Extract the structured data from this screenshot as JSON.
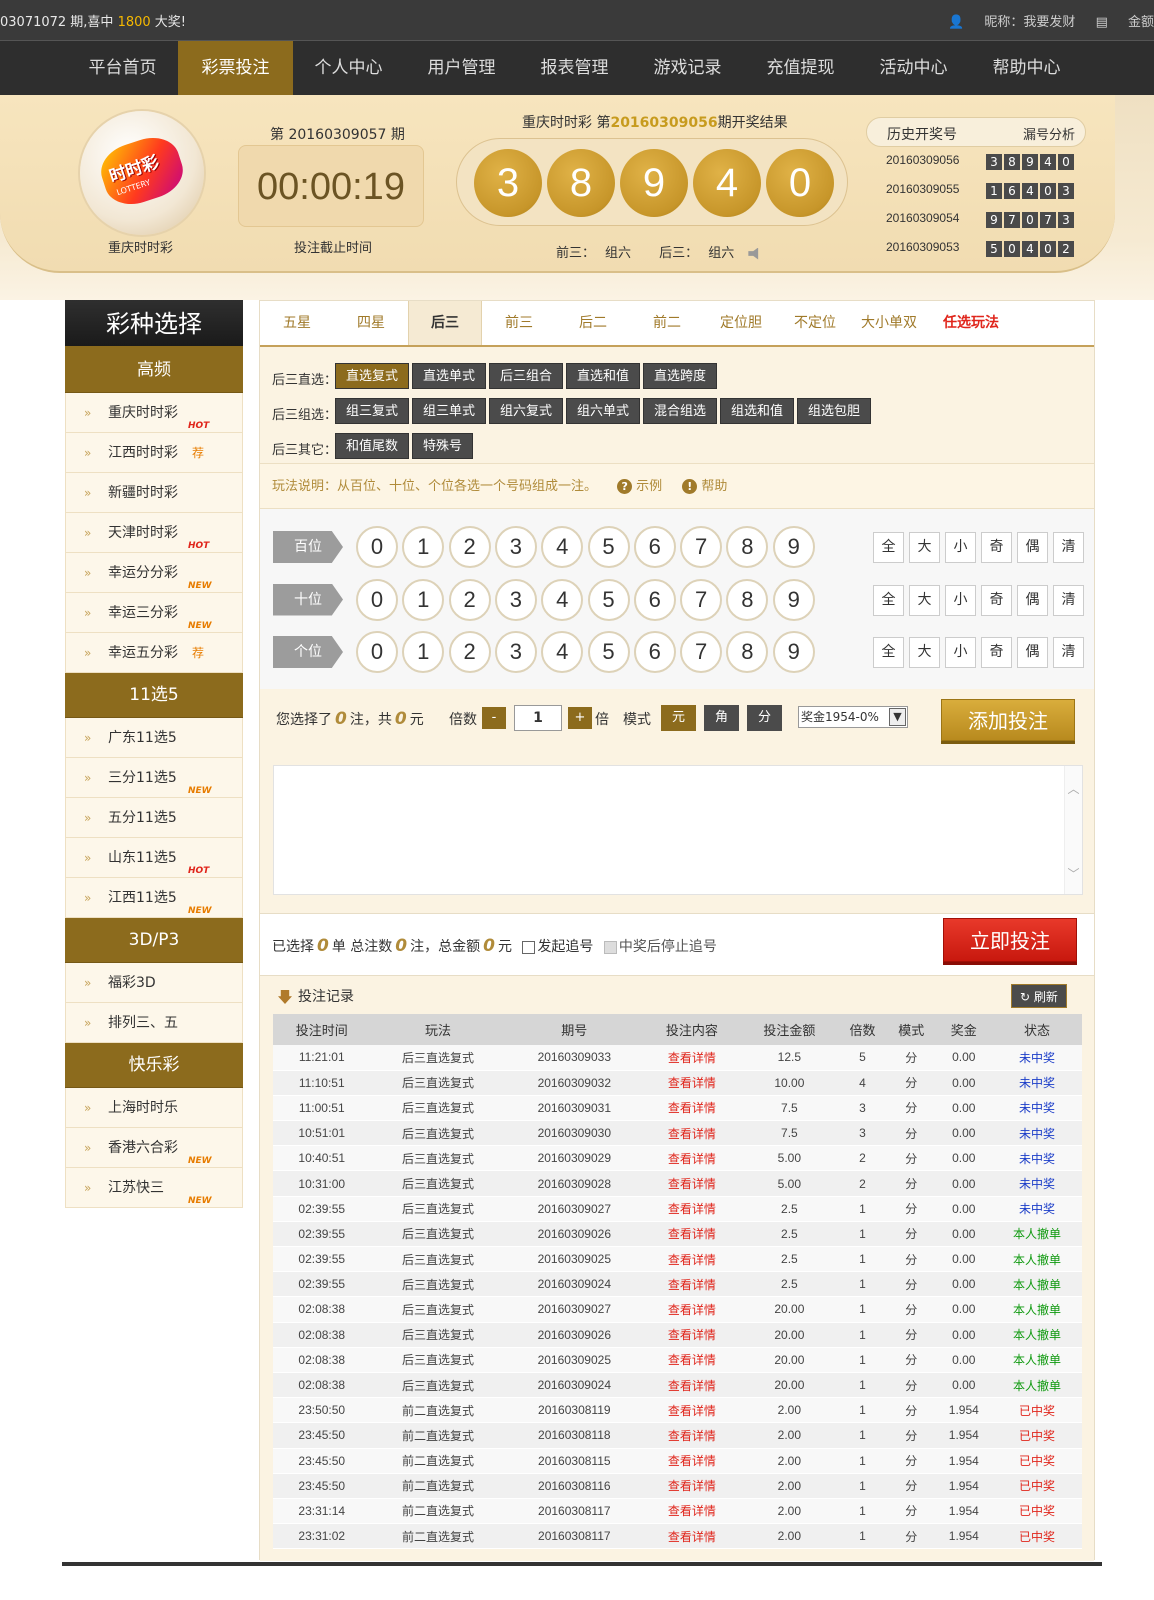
{
  "topbar": {
    "notice_prefix": "03071072 期,喜中 ",
    "notice_amount": "1800",
    "notice_suffix": " 大奖!",
    "nickname": "昵称：我要发财",
    "balance": "金额"
  },
  "nav": [
    "平台首页",
    "彩票投注",
    "个人中心",
    "用户管理",
    "报表管理",
    "游戏记录",
    "充值提现",
    "活动中心",
    "帮助中心"
  ],
  "nav_active": 1,
  "hero": {
    "game_name": "重庆时时彩",
    "logo_text": "时时彩",
    "logo_sub": "LOTTERY",
    "period": "第 20160309057 期",
    "countdown": "00:00:19",
    "countdown_label": "投注截止时间",
    "draw_title_prefix": "重庆时时彩 第",
    "draw_period": "20160309056",
    "draw_title_suffix": "期开奖结果",
    "balls": [
      "3",
      "8",
      "9",
      "4",
      "0"
    ],
    "front3_label": "前三：",
    "front3_value": "组六",
    "back3_label": "后三：",
    "back3_value": "组六",
    "history_title": "历史开奖号",
    "history_link": "漏号分析",
    "history": [
      {
        "no": "20160309056",
        "nums": [
          "3",
          "8",
          "9",
          "4",
          "0"
        ]
      },
      {
        "no": "20160309055",
        "nums": [
          "1",
          "6",
          "4",
          "0",
          "3"
        ]
      },
      {
        "no": "20160309054",
        "nums": [
          "9",
          "7",
          "0",
          "7",
          "3"
        ]
      },
      {
        "no": "20160309053",
        "nums": [
          "5",
          "0",
          "4",
          "0",
          "2"
        ]
      }
    ]
  },
  "sidebar": {
    "title": "彩种选择",
    "groups": [
      {
        "name": "高频",
        "items": [
          {
            "label": "重庆时时彩",
            "tag": "HOT"
          },
          {
            "label": "江西时时彩",
            "tag": "荐"
          },
          {
            "label": "新疆时时彩",
            "tag": ""
          },
          {
            "label": "天津时时彩",
            "tag": "HOT"
          },
          {
            "label": "幸运分分彩",
            "tag": "NEW"
          },
          {
            "label": "幸运三分彩",
            "tag": "NEW"
          },
          {
            "label": "幸运五分彩",
            "tag": "荐"
          }
        ]
      },
      {
        "name": "11选5",
        "items": [
          {
            "label": "广东11选5",
            "tag": ""
          },
          {
            "label": "三分11选5",
            "tag": "NEW"
          },
          {
            "label": "五分11选5",
            "tag": ""
          },
          {
            "label": "山东11选5",
            "tag": "HOT"
          },
          {
            "label": "江西11选5",
            "tag": "NEW"
          }
        ]
      },
      {
        "name": "3D/P3",
        "items": [
          {
            "label": "福彩3D",
            "tag": ""
          },
          {
            "label": "排列三、五",
            "tag": ""
          }
        ]
      },
      {
        "name": "快乐彩",
        "items": [
          {
            "label": "上海时时乐",
            "tag": ""
          },
          {
            "label": "香港六合彩",
            "tag": "NEW"
          },
          {
            "label": "江苏快三",
            "tag": "NEW"
          }
        ]
      }
    ]
  },
  "tabs": [
    "五星",
    "四星",
    "后三",
    "前三",
    "后二",
    "前二",
    "定位胆",
    "不定位",
    "大小单双",
    "任选玩法"
  ],
  "tab_active": 2,
  "subplays": [
    {
      "label": "后三直选：",
      "buttons": [
        "直选复式",
        "直选单式",
        "后三组合",
        "直选和值",
        "直选跨度"
      ],
      "active": 0
    },
    {
      "label": "后三组选：",
      "buttons": [
        "组三复式",
        "组三单式",
        "组六复式",
        "组六单式",
        "混合组选",
        "组选和值",
        "组选包胆"
      ],
      "active": -1
    },
    {
      "label": "后三其它：",
      "buttons": [
        "和值尾数",
        "特殊号"
      ],
      "active": -1
    }
  ],
  "desc": {
    "text": "玩法说明：从百位、十位、个位各选一个号码组成一注。",
    "example": "示例",
    "help": "帮助"
  },
  "picker": {
    "rows": [
      "百位",
      "十位",
      "个位"
    ],
    "digits": [
      "0",
      "1",
      "2",
      "3",
      "4",
      "5",
      "6",
      "7",
      "8",
      "9"
    ],
    "quick": [
      "全",
      "大",
      "小",
      "奇",
      "偶",
      "清"
    ]
  },
  "bet": {
    "selected_prefix": "您选择了",
    "selected_count": "0",
    "selected_mid": "注，共",
    "selected_amount": "0",
    "selected_unit": "元",
    "mult_label": "倍数",
    "minus": "-",
    "mult_value": "1",
    "plus": "+",
    "mult_unit": "倍",
    "mode_label": "模式",
    "modes": [
      "元",
      "角",
      "分"
    ],
    "mode_active": 0,
    "prize": "奖金1954-0%",
    "add_button": "添加投注"
  },
  "summary": {
    "p1": "已选择",
    "orders": "0",
    "p2": "单 总注数",
    "notes": "0",
    "p3": "注，总金额",
    "amount": "0",
    "p4": "元",
    "chase": "发起追号",
    "stop_chase": "中奖后停止追号",
    "submit": "立即投注"
  },
  "records": {
    "title": "投注记录",
    "refresh": "刷新",
    "columns": [
      "投注时间",
      "玩法",
      "期号",
      "投注内容",
      "投注金额",
      "倍数",
      "模式",
      "奖金",
      "状态"
    ],
    "rows": [
      [
        "11:21:01",
        "后三直选复式",
        "20160309033",
        "查看详情",
        "12.5",
        "5",
        "分",
        "0.00",
        "未中奖"
      ],
      [
        "11:10:51",
        "后三直选复式",
        "20160309032",
        "查看详情",
        "10.00",
        "4",
        "分",
        "0.00",
        "未中奖"
      ],
      [
        "11:00:51",
        "后三直选复式",
        "20160309031",
        "查看详情",
        "7.5",
        "3",
        "分",
        "0.00",
        "未中奖"
      ],
      [
        "10:51:01",
        "后三直选复式",
        "20160309030",
        "查看详情",
        "7.5",
        "3",
        "分",
        "0.00",
        "未中奖"
      ],
      [
        "10:40:51",
        "后三直选复式",
        "20160309029",
        "查看详情",
        "5.00",
        "2",
        "分",
        "0.00",
        "未中奖"
      ],
      [
        "10:31:00",
        "后三直选复式",
        "20160309028",
        "查看详情",
        "5.00",
        "2",
        "分",
        "0.00",
        "未中奖"
      ],
      [
        "02:39:55",
        "后三直选复式",
        "20160309027",
        "查看详情",
        "2.5",
        "1",
        "分",
        "0.00",
        "未中奖"
      ],
      [
        "02:39:55",
        "后三直选复式",
        "20160309026",
        "查看详情",
        "2.5",
        "1",
        "分",
        "0.00",
        "本人撤单"
      ],
      [
        "02:39:55",
        "后三直选复式",
        "20160309025",
        "查看详情",
        "2.5",
        "1",
        "分",
        "0.00",
        "本人撤单"
      ],
      [
        "02:39:55",
        "后三直选复式",
        "20160309024",
        "查看详情",
        "2.5",
        "1",
        "分",
        "0.00",
        "本人撤单"
      ],
      [
        "02:08:38",
        "后三直选复式",
        "20160309027",
        "查看详情",
        "20.00",
        "1",
        "分",
        "0.00",
        "本人撤单"
      ],
      [
        "02:08:38",
        "后三直选复式",
        "20160309026",
        "查看详情",
        "20.00",
        "1",
        "分",
        "0.00",
        "本人撤单"
      ],
      [
        "02:08:38",
        "后三直选复式",
        "20160309025",
        "查看详情",
        "20.00",
        "1",
        "分",
        "0.00",
        "本人撤单"
      ],
      [
        "02:08:38",
        "后三直选复式",
        "20160309024",
        "查看详情",
        "20.00",
        "1",
        "分",
        "0.00",
        "本人撤单"
      ],
      [
        "23:50:50",
        "前二直选复式",
        "20160308119",
        "查看详情",
        "2.00",
        "1",
        "分",
        "1.954",
        "已中奖"
      ],
      [
        "23:45:50",
        "前二直选复式",
        "20160308118",
        "查看详情",
        "2.00",
        "1",
        "分",
        "1.954",
        "已中奖"
      ],
      [
        "23:45:50",
        "前二直选复式",
        "20160308115",
        "查看详情",
        "2.00",
        "1",
        "分",
        "1.954",
        "已中奖"
      ],
      [
        "23:45:50",
        "前二直选复式",
        "20160308116",
        "查看详情",
        "2.00",
        "1",
        "分",
        "1.954",
        "已中奖"
      ],
      [
        "23:31:14",
        "前二直选复式",
        "20160308117",
        "查看详情",
        "2.00",
        "1",
        "分",
        "1.954",
        "已中奖"
      ],
      [
        "23:31:02",
        "前二直选复式",
        "20160308117",
        "查看详情",
        "2.00",
        "1",
        "分",
        "1.954",
        "已中奖"
      ]
    ]
  },
  "colors": {
    "gold": "#8c6b1d",
    "ball": "#c7962a",
    "red": "#e0251b",
    "blue": "#1a3cc8",
    "green": "#109a10"
  }
}
